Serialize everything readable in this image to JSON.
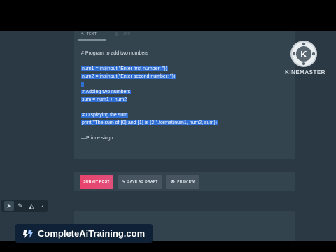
{
  "editor": {
    "tabs": [
      {
        "label": "TEXT",
        "icon": "pencil-icon"
      },
      {
        "label": "LINK",
        "icon": "link-icon"
      }
    ],
    "code_lines": [
      {
        "text": "# Program to add two numbers",
        "selected": false
      },
      {
        "text": "",
        "selected": false
      },
      {
        "text": "num1 = int(input(\"Enter first number: \"))",
        "selected": true
      },
      {
        "text": "num2 = int(input(\"Enter second number: \"))",
        "selected": true
      },
      {
        "text": "",
        "selected": true
      },
      {
        "text": "# Adding two numbers",
        "selected": true
      },
      {
        "text": "sum = num1 + num2",
        "selected": true
      },
      {
        "text": "",
        "selected": false
      },
      {
        "text": "# Displaying the sum",
        "selected": true
      },
      {
        "text": "print(\"The sum of {0} and {1} is {2}\".format(num1, num2, sum))",
        "selected": true
      },
      {
        "text": "",
        "selected": false
      },
      {
        "text": "—Prince singh",
        "selected": false
      }
    ]
  },
  "actions": {
    "submit_label": "SUBMIT POST",
    "draft_label": "SAVE AS DRAFT",
    "preview_label": "PREVIEW"
  },
  "watermark": {
    "brand": "KINEMASTER"
  },
  "banner": {
    "text": "CompleteAiTraining.com"
  },
  "colors": {
    "selection": "#2f6fd4",
    "submit": "#e8436b",
    "panel": "#34444f",
    "background": "#2a3944"
  }
}
